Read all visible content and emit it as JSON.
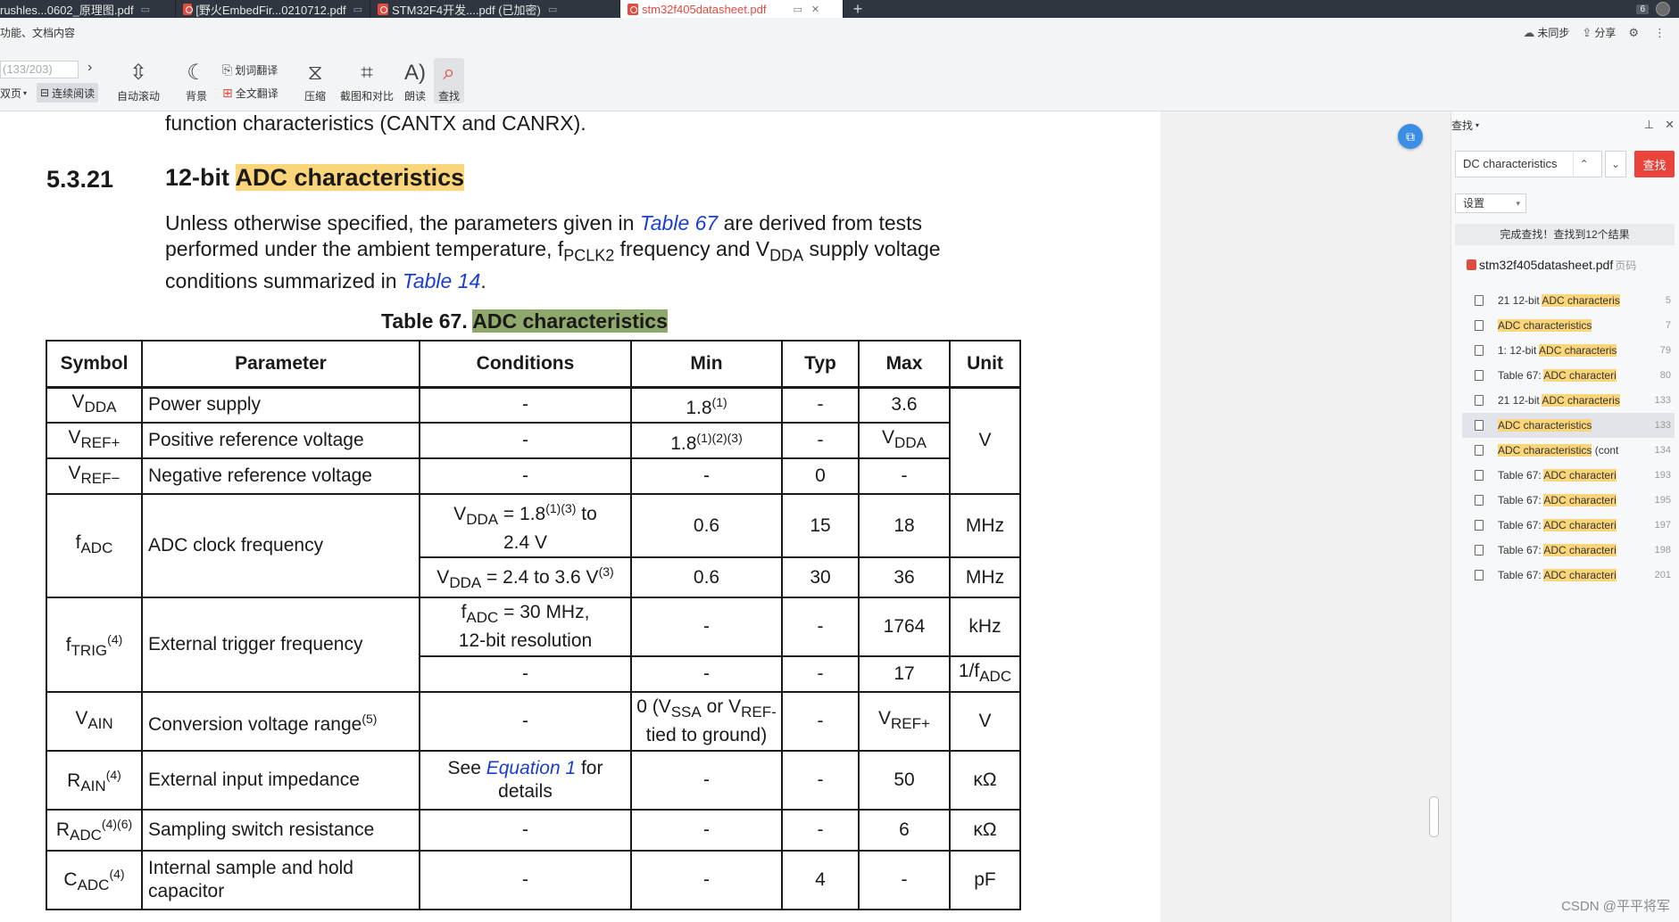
{
  "tabs": [
    {
      "label": "rushles...0602_原理图.pdf",
      "active": false
    },
    {
      "label": "[野火EmbedFir...0210712.pdf",
      "active": false
    },
    {
      "label": "STM32F4开发....pdf (已加密)",
      "active": false
    },
    {
      "label": "stm32f405datasheet.pdf",
      "active": true
    }
  ],
  "tabbar_right": {
    "count": "6"
  },
  "menu": {
    "functions_label": "功能、文档内容"
  },
  "top_right": {
    "sync": "未同步",
    "share": "分享"
  },
  "toolbar": {
    "page_input_placeholder": "(133/203)",
    "double_page": "双页",
    "continuous": "连续阅读",
    "auto_scroll": "自动滚动",
    "background": "背景",
    "word_translate": "划词翻译",
    "full_translate": "全文翻译",
    "compress": "压缩",
    "screenshot_compare": "截图和对比",
    "read_aloud": "朗读",
    "find": "查找"
  },
  "document": {
    "prev_line": "function characteristics (CANTX and CANRX).",
    "section_number": "5.3.21",
    "section_title_plain": "12-bit ",
    "section_title_hl": "ADC characteristics",
    "para": {
      "p1": "Unless otherwise specified, the parameters given in ",
      "link1": "Table 67",
      "p2": " are derived from tests performed under the ambient temperature, f",
      "sub1": "PCLK2",
      "p3": " frequency and V",
      "sub2": "DDA",
      "p4": " supply voltage conditions summarized in ",
      "link2": "Table 14",
      "p5": "."
    },
    "caption_plain": "Table 67. ",
    "caption_hl": "ADC characteristics",
    "table": {
      "headers": [
        "Symbol",
        "Parameter",
        "Conditions",
        "Min",
        "Typ",
        "Max",
        "Unit"
      ],
      "r1": {
        "param": "Power supply",
        "cond": "-",
        "min": "1.8",
        "min_sup": "(1)",
        "typ": "-",
        "max": "3.6",
        "unit": "V"
      },
      "r2": {
        "param": "Positive reference voltage",
        "cond": "-",
        "min": "1.8",
        "min_sup": "(1)(2)(3)",
        "typ": "-"
      },
      "r3": {
        "param": "Negative reference voltage",
        "cond": "-",
        "min": "-",
        "typ": "0",
        "max": "-"
      },
      "r4": {
        "param": "ADC clock frequency",
        "cond_a_mid": " = 1.8",
        "cond_a_sup": "(1)(3)",
        "cond_a_tail": " to",
        "cond_a_line2": "2.4 V",
        "min_a": "0.6",
        "typ_a": "15",
        "max_a": "18",
        "unit_a": "MHz",
        "cond_b_mid": " = 2.4 to 3.6 V",
        "cond_b_sup": "(3)",
        "min_b": "0.6",
        "typ_b": "30",
        "max_b": "36",
        "unit_b": "MHz"
      },
      "r5": {
        "param": "External trigger frequency",
        "cond_a_mid": " = 30 MHz,",
        "cond_a_line2": "12-bit resolution",
        "min_a": "-",
        "typ_a": "-",
        "max_a": "1764",
        "unit_a": "kHz",
        "cond_b": "-",
        "min_b": "-",
        "typ_b": "-",
        "max_b": "17",
        "unit_b_pre": "1/f"
      },
      "r6": {
        "param": "Conversion voltage range",
        "param_sup": "(5)",
        "cond": "-",
        "min_l1a": "0 (V",
        "min_l1b": " or V",
        "min_l2": "tied to ground)",
        "typ": "-",
        "max_sub": "REF+",
        "unit": "V"
      },
      "r7": {
        "param": "External input impedance",
        "cond_pre": "See ",
        "cond_link": "Equation 1",
        "cond_post": " for",
        "cond_line2": "details",
        "min": "-",
        "typ": "-",
        "max": "50",
        "unit": "κΩ"
      },
      "r8": {
        "param": "Sampling switch resistance",
        "cond": "-",
        "min": "-",
        "typ": "-",
        "max": "6",
        "unit": "κΩ"
      },
      "r9": {
        "param_l1": "Internal sample and hold",
        "param_l2": "capacitor",
        "cond": "-",
        "min": "-",
        "typ": "4",
        "max": "-",
        "unit": "pF"
      },
      "sym": {
        "v": "V",
        "f": "f",
        "r": "R",
        "c": "C",
        "dda": "DDA",
        "refp": "REF+",
        "refm": "REF−",
        "adc": "ADC",
        "trig": "TRIG",
        "ain": "AIN",
        "ssa": "SSA",
        "refm2": "REF-",
        "s4": "(4)",
        "s46": "(4)(6)"
      }
    }
  },
  "find_panel": {
    "title": "查找",
    "query": "DC characteristics",
    "find_button": "查找",
    "settings": "设置",
    "summary": "完成查找！查找到12个结果",
    "file_name": "stm32f405datasheet.pdf",
    "page_label": "页码",
    "results": [
      {
        "pre": "21 12-bit ",
        "hit": "ADC characteris",
        "post": "",
        "page": "5"
      },
      {
        "pre": "",
        "hit": "ADC characteristics",
        "post": "",
        "page": "7"
      },
      {
        "pre": "1: 12-bit ",
        "hit": "ADC characteris",
        "post": "",
        "page": "79"
      },
      {
        "pre": "Table 67: ",
        "hit": "ADC characteri",
        "post": "",
        "page": "80"
      },
      {
        "pre": "21 12-bit ",
        "hit": "ADC characteris",
        "post": "",
        "page": "133"
      },
      {
        "pre": "",
        "hit": "ADC characteristics",
        "post": "",
        "page": "133",
        "selected": true
      },
      {
        "pre": "",
        "hit": "ADC characteristics",
        "post": " (cont",
        "page": "134"
      },
      {
        "pre": "Table 67: ",
        "hit": "ADC characteri",
        "post": "",
        "page": "193"
      },
      {
        "pre": "Table 67: ",
        "hit": "ADC characteri",
        "post": "",
        "page": "195"
      },
      {
        "pre": "Table 67: ",
        "hit": "ADC characteri",
        "post": "",
        "page": "197"
      },
      {
        "pre": "Table 67: ",
        "hit": "ADC characteri",
        "post": "",
        "page": "198"
      },
      {
        "pre": "Table 67: ",
        "hit": "ADC characteri",
        "post": "",
        "page": "201"
      }
    ]
  },
  "watermark": "CSDN @平平将军"
}
